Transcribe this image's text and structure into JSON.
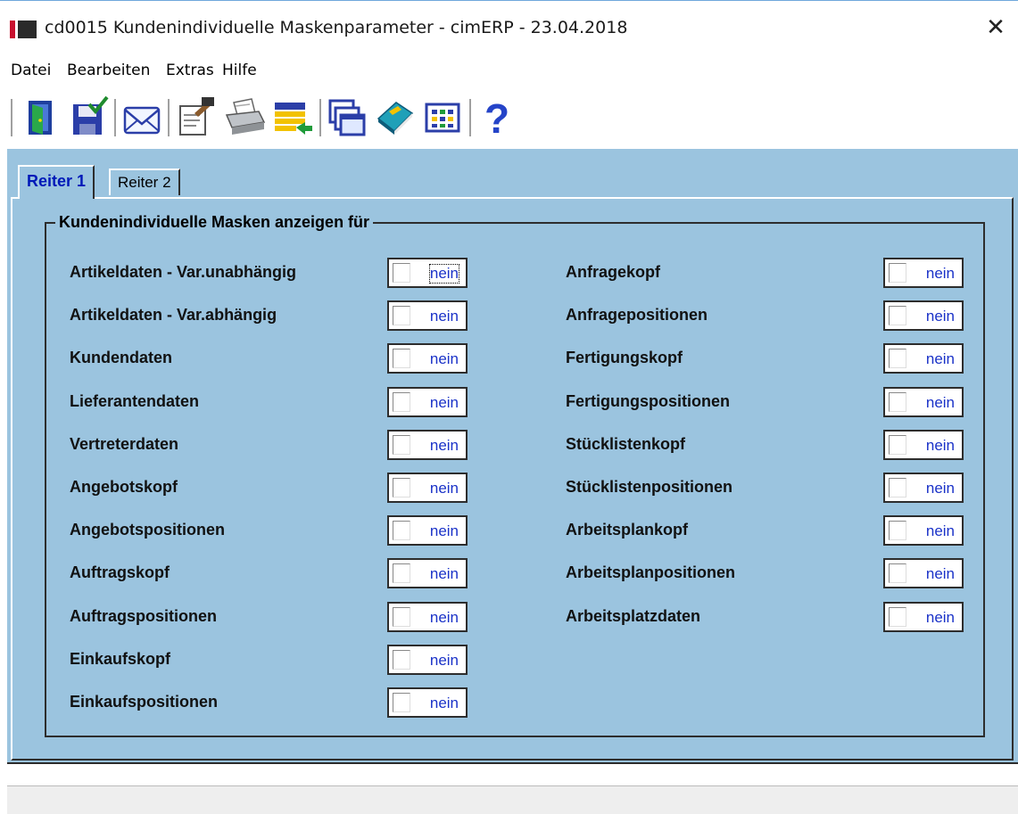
{
  "window": {
    "title": "cd0015 Kundenindividuelle Maskenparameter - cimERP - 23.04.2018",
    "close_glyph": "✕"
  },
  "menu": [
    "Datei",
    "Bearbeiten",
    "Extras",
    "Hilfe"
  ],
  "toolbar": {
    "icons": [
      "exit-door-icon",
      "save-disk-icon",
      "mail-envelope-icon",
      "edit-notepad-icon",
      "printer-icon",
      "list-transfer-icon",
      "windows-stack-icon",
      "book-icon",
      "grid-table-icon",
      "help-question-icon"
    ]
  },
  "tabs": [
    {
      "label": "Reiter 1",
      "active": true
    },
    {
      "label": "Reiter 2",
      "active": false
    }
  ],
  "group": {
    "title": "Kundenindividuelle Masken anzeigen für",
    "left_items": [
      {
        "label": "Artikeldaten - Var.unabhängig",
        "value": "nein",
        "checked": false
      },
      {
        "label": "Artikeldaten - Var.abhängig",
        "value": "nein",
        "checked": false
      },
      {
        "label": "Kundendaten",
        "value": "nein",
        "checked": false
      },
      {
        "label": "Lieferantendaten",
        "value": "nein",
        "checked": false
      },
      {
        "label": "Vertreterdaten",
        "value": "nein",
        "checked": false
      },
      {
        "label": "Angebotskopf",
        "value": "nein",
        "checked": false
      },
      {
        "label": "Angebotspositionen",
        "value": "nein",
        "checked": false
      },
      {
        "label": "Auftragskopf",
        "value": "nein",
        "checked": false
      },
      {
        "label": "Auftragspositionen",
        "value": "nein",
        "checked": false
      },
      {
        "label": "Einkaufskopf",
        "value": "nein",
        "checked": false
      },
      {
        "label": "Einkaufspositionen",
        "value": "nein",
        "checked": false
      }
    ],
    "right_items": [
      {
        "label": "Anfragekopf",
        "value": "nein",
        "checked": false
      },
      {
        "label": "Anfragepositionen",
        "value": "nein",
        "checked": false
      },
      {
        "label": "Fertigungskopf",
        "value": "nein",
        "checked": false
      },
      {
        "label": "Fertigungspositionen",
        "value": "nein",
        "checked": false
      },
      {
        "label": "Stücklistenkopf",
        "value": "nein",
        "checked": false
      },
      {
        "label": "Stücklistenpositionen",
        "value": "nein",
        "checked": false
      },
      {
        "label": "Arbeitsplankopf",
        "value": "nein",
        "checked": false
      },
      {
        "label": "Arbeitsplanpositionen",
        "value": "nein",
        "checked": false
      },
      {
        "label": "Arbeitsplatzdaten",
        "value": "nein",
        "checked": false
      }
    ]
  },
  "colors": {
    "panel_bg": "#9bc4df",
    "value_text": "#1a32c8",
    "active_tab_text": "#0019b8"
  }
}
